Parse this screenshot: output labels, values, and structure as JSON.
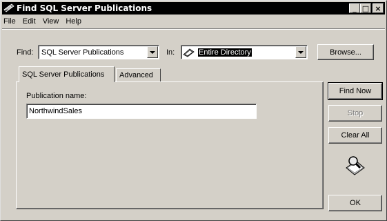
{
  "window": {
    "title": "Find SQL Server Publications",
    "title_icon": "find-flashlight-icon",
    "minimize_glyph": "_",
    "maximize_glyph": "□",
    "close_glyph": "×"
  },
  "menu": {
    "file": "File",
    "edit": "Edit",
    "view": "View",
    "help": "Help"
  },
  "find_row": {
    "find_label": "Find:",
    "find_value": "SQL Server Publications",
    "in_label": "In:",
    "in_icon": "directory-book-icon",
    "in_value": "Entire Directory",
    "browse_label": "Browse..."
  },
  "tabs": [
    {
      "label": "SQL Server Publications",
      "active": true
    },
    {
      "label": "Advanced",
      "active": false
    }
  ],
  "form": {
    "publication_label": "Publication name:",
    "publication_value": "NorthwindSales"
  },
  "buttons": {
    "find_now": "Find Now",
    "stop": "Stop",
    "clear_all": "Clear All",
    "ok": "OK"
  },
  "search_graphic_icon": "magnifier-search-icon",
  "colors": {
    "face": "#d4d0c8",
    "titlebar": "#000000",
    "highlight": "#000000"
  }
}
